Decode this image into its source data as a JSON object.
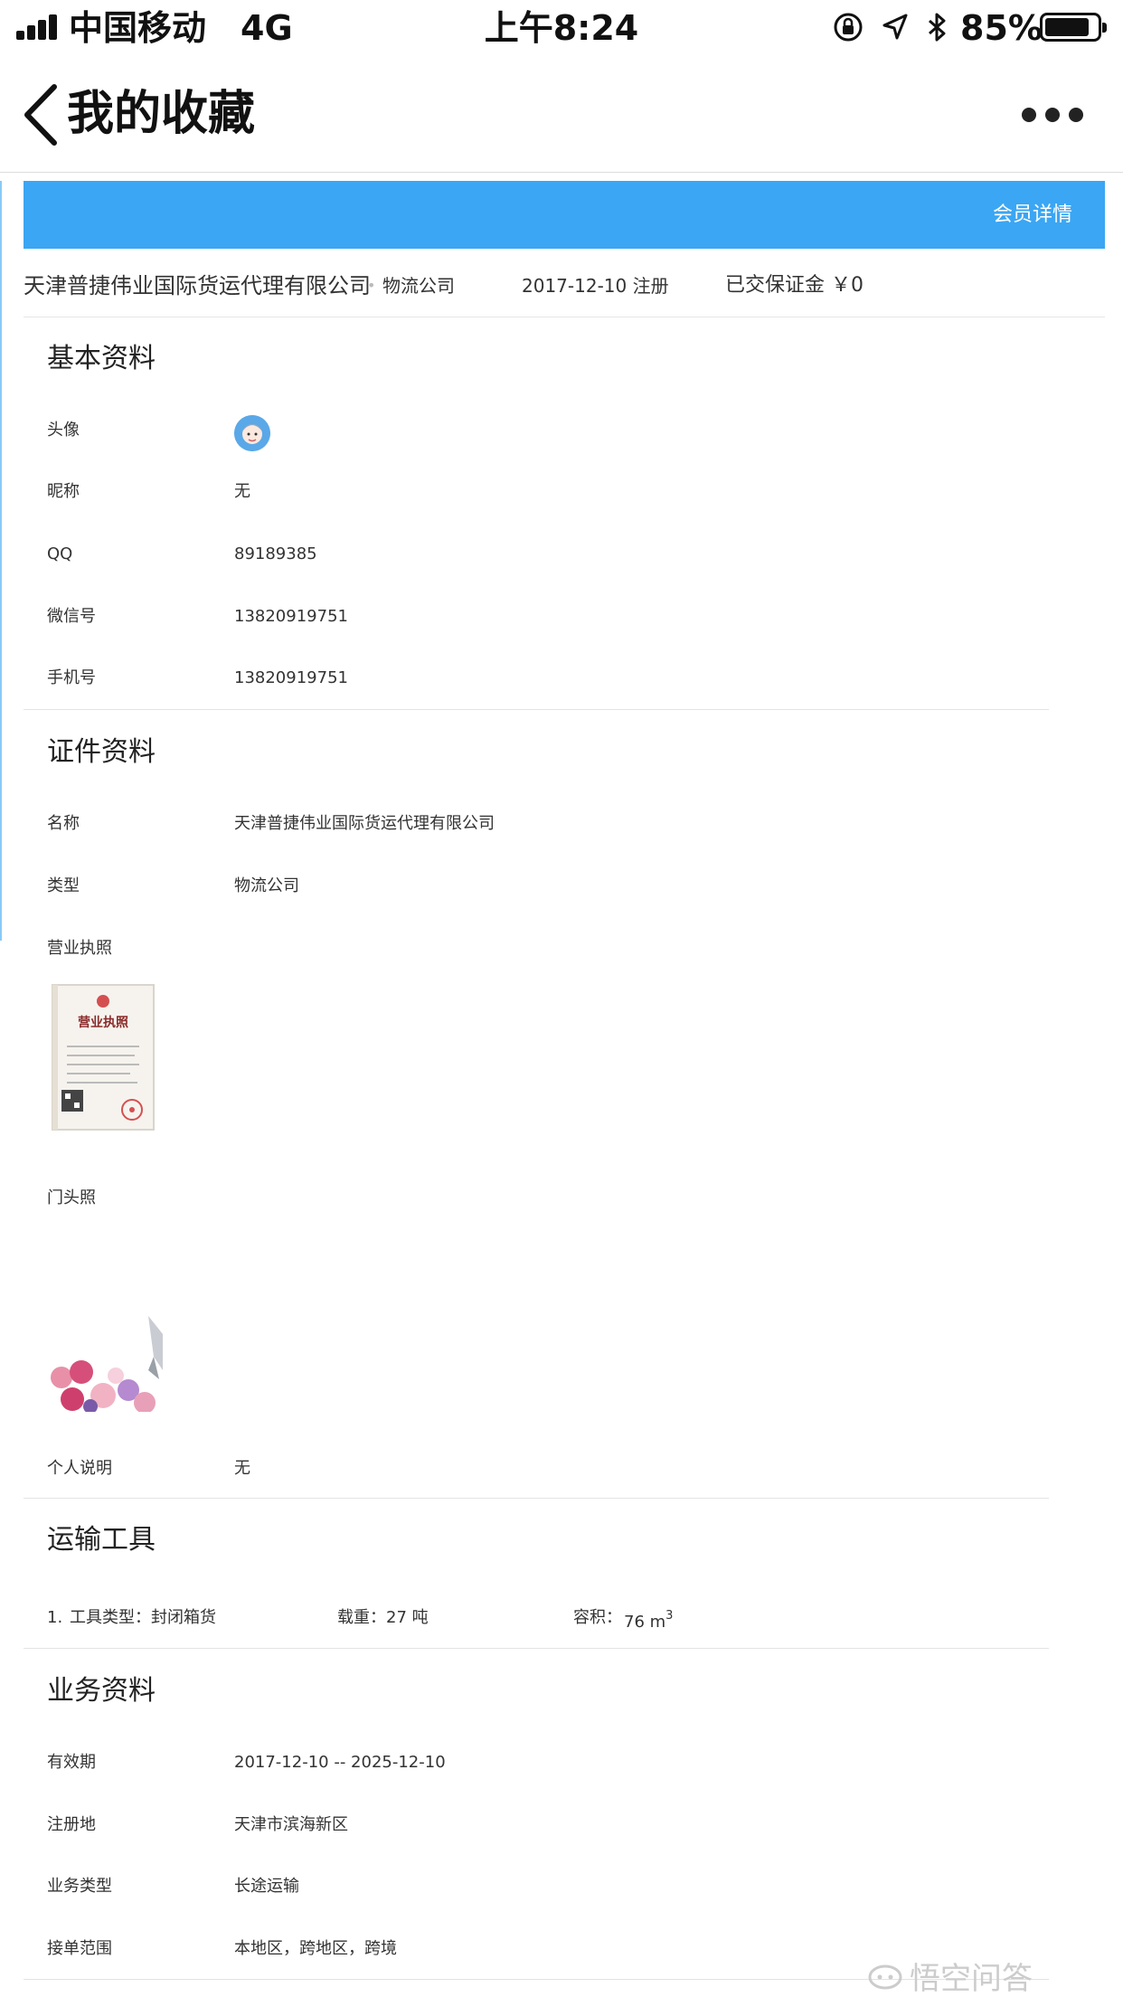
{
  "status_bar": {
    "carrier": "中国移动",
    "network": "4G",
    "time": "上午8:24",
    "battery_percent": "85%",
    "battery_level": 0.85
  },
  "nav": {
    "title": "我的收藏"
  },
  "banner": {
    "link_label": "会员详情",
    "color": "#3ba6f3"
  },
  "summary": {
    "company_name": "天津普捷伟业国际货运代理有限公司",
    "company_type": "物流公司",
    "registered": "2017-12-10 注册",
    "deposit": "已交保证金 ￥0"
  },
  "basic_info": {
    "title": "基本资料",
    "fields": [
      {
        "label": "头像",
        "value": ""
      },
      {
        "label": "昵称",
        "value": "无"
      },
      {
        "label": "QQ",
        "value": "89189385"
      },
      {
        "label": "微信号",
        "value": "13820919751"
      },
      {
        "label": "手机号",
        "value": "13820919751"
      }
    ]
  },
  "certificates": {
    "title": "证件资料",
    "name_label": "名称",
    "name_value": "天津普捷伟业国际货运代理有限公司",
    "type_label": "类型",
    "type_value": "物流公司",
    "license_label": "营业执照",
    "license_image_text": "营业执照",
    "storefront_label": "门头照",
    "note_label": "个人说明",
    "note_value": "无"
  },
  "vehicles": {
    "title": "运输工具",
    "items": [
      {
        "index": "1.",
        "type": "工具类型：封闭箱货",
        "load": "载重：27 吨",
        "volume_label": "容积：",
        "volume_value": "76 m",
        "volume_unit_sup": "3"
      }
    ]
  },
  "business": {
    "title": "业务资料",
    "fields": [
      {
        "label": "有效期",
        "value": "2017-12-10 -- 2025-12-10"
      },
      {
        "label": "注册地",
        "value": "天津市滨海新区"
      },
      {
        "label": "业务类型",
        "value": "长途运输"
      },
      {
        "label": "接单范围",
        "value": "本地区，跨地区，跨境"
      }
    ]
  },
  "watermark": {
    "text": "悟空问答"
  }
}
